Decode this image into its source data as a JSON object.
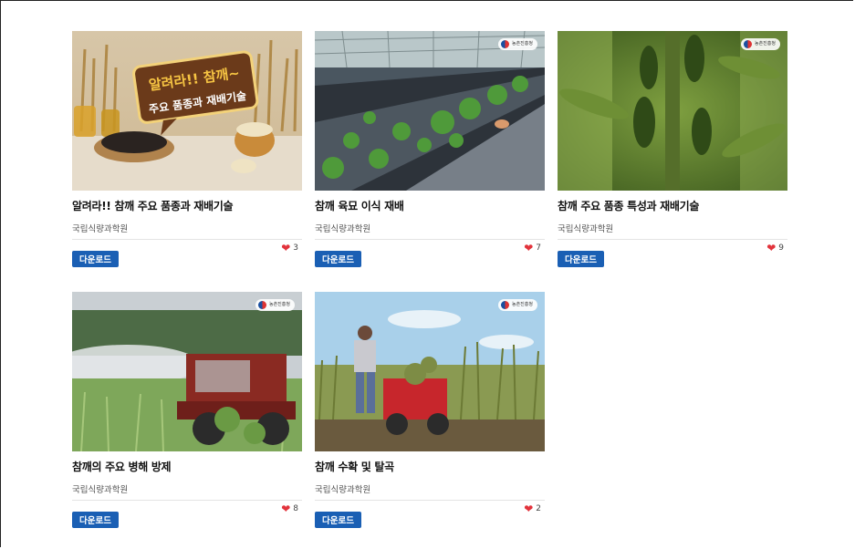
{
  "cards": [
    {
      "title": "알려라!! 참깨 주요 품종과 재배기술",
      "org": "국립식량과학원",
      "likes": "3",
      "download_label": "다운로드",
      "banner_line1": "알려라!! 참깨~",
      "banner_line2": "주요 품종과 재배기술"
    },
    {
      "title": "참깨 육묘 이식 재배",
      "org": "국립식량과학원",
      "likes": "7",
      "download_label": "다운로드",
      "badge": "농촌진흥청"
    },
    {
      "title": "참깨 주요 품종 특성과 재배기술",
      "org": "국립식량과학원",
      "likes": "9",
      "download_label": "다운로드",
      "badge": "농촌진흥청"
    },
    {
      "title": "참깨의 주요 병해 방제",
      "org": "국립식량과학원",
      "likes": "8",
      "download_label": "다운로드",
      "badge": "농촌진흥청"
    },
    {
      "title": "참깨 수확 및 탈곡",
      "org": "국립식량과학원",
      "likes": "2",
      "download_label": "다운로드",
      "badge": "농촌진흥청"
    }
  ],
  "icons": {
    "like": "heart-icon",
    "badge_logo": "taegeuk-logo-icon"
  },
  "colors": {
    "download_button": "#1a5fb4",
    "heart": "#e2333c"
  }
}
